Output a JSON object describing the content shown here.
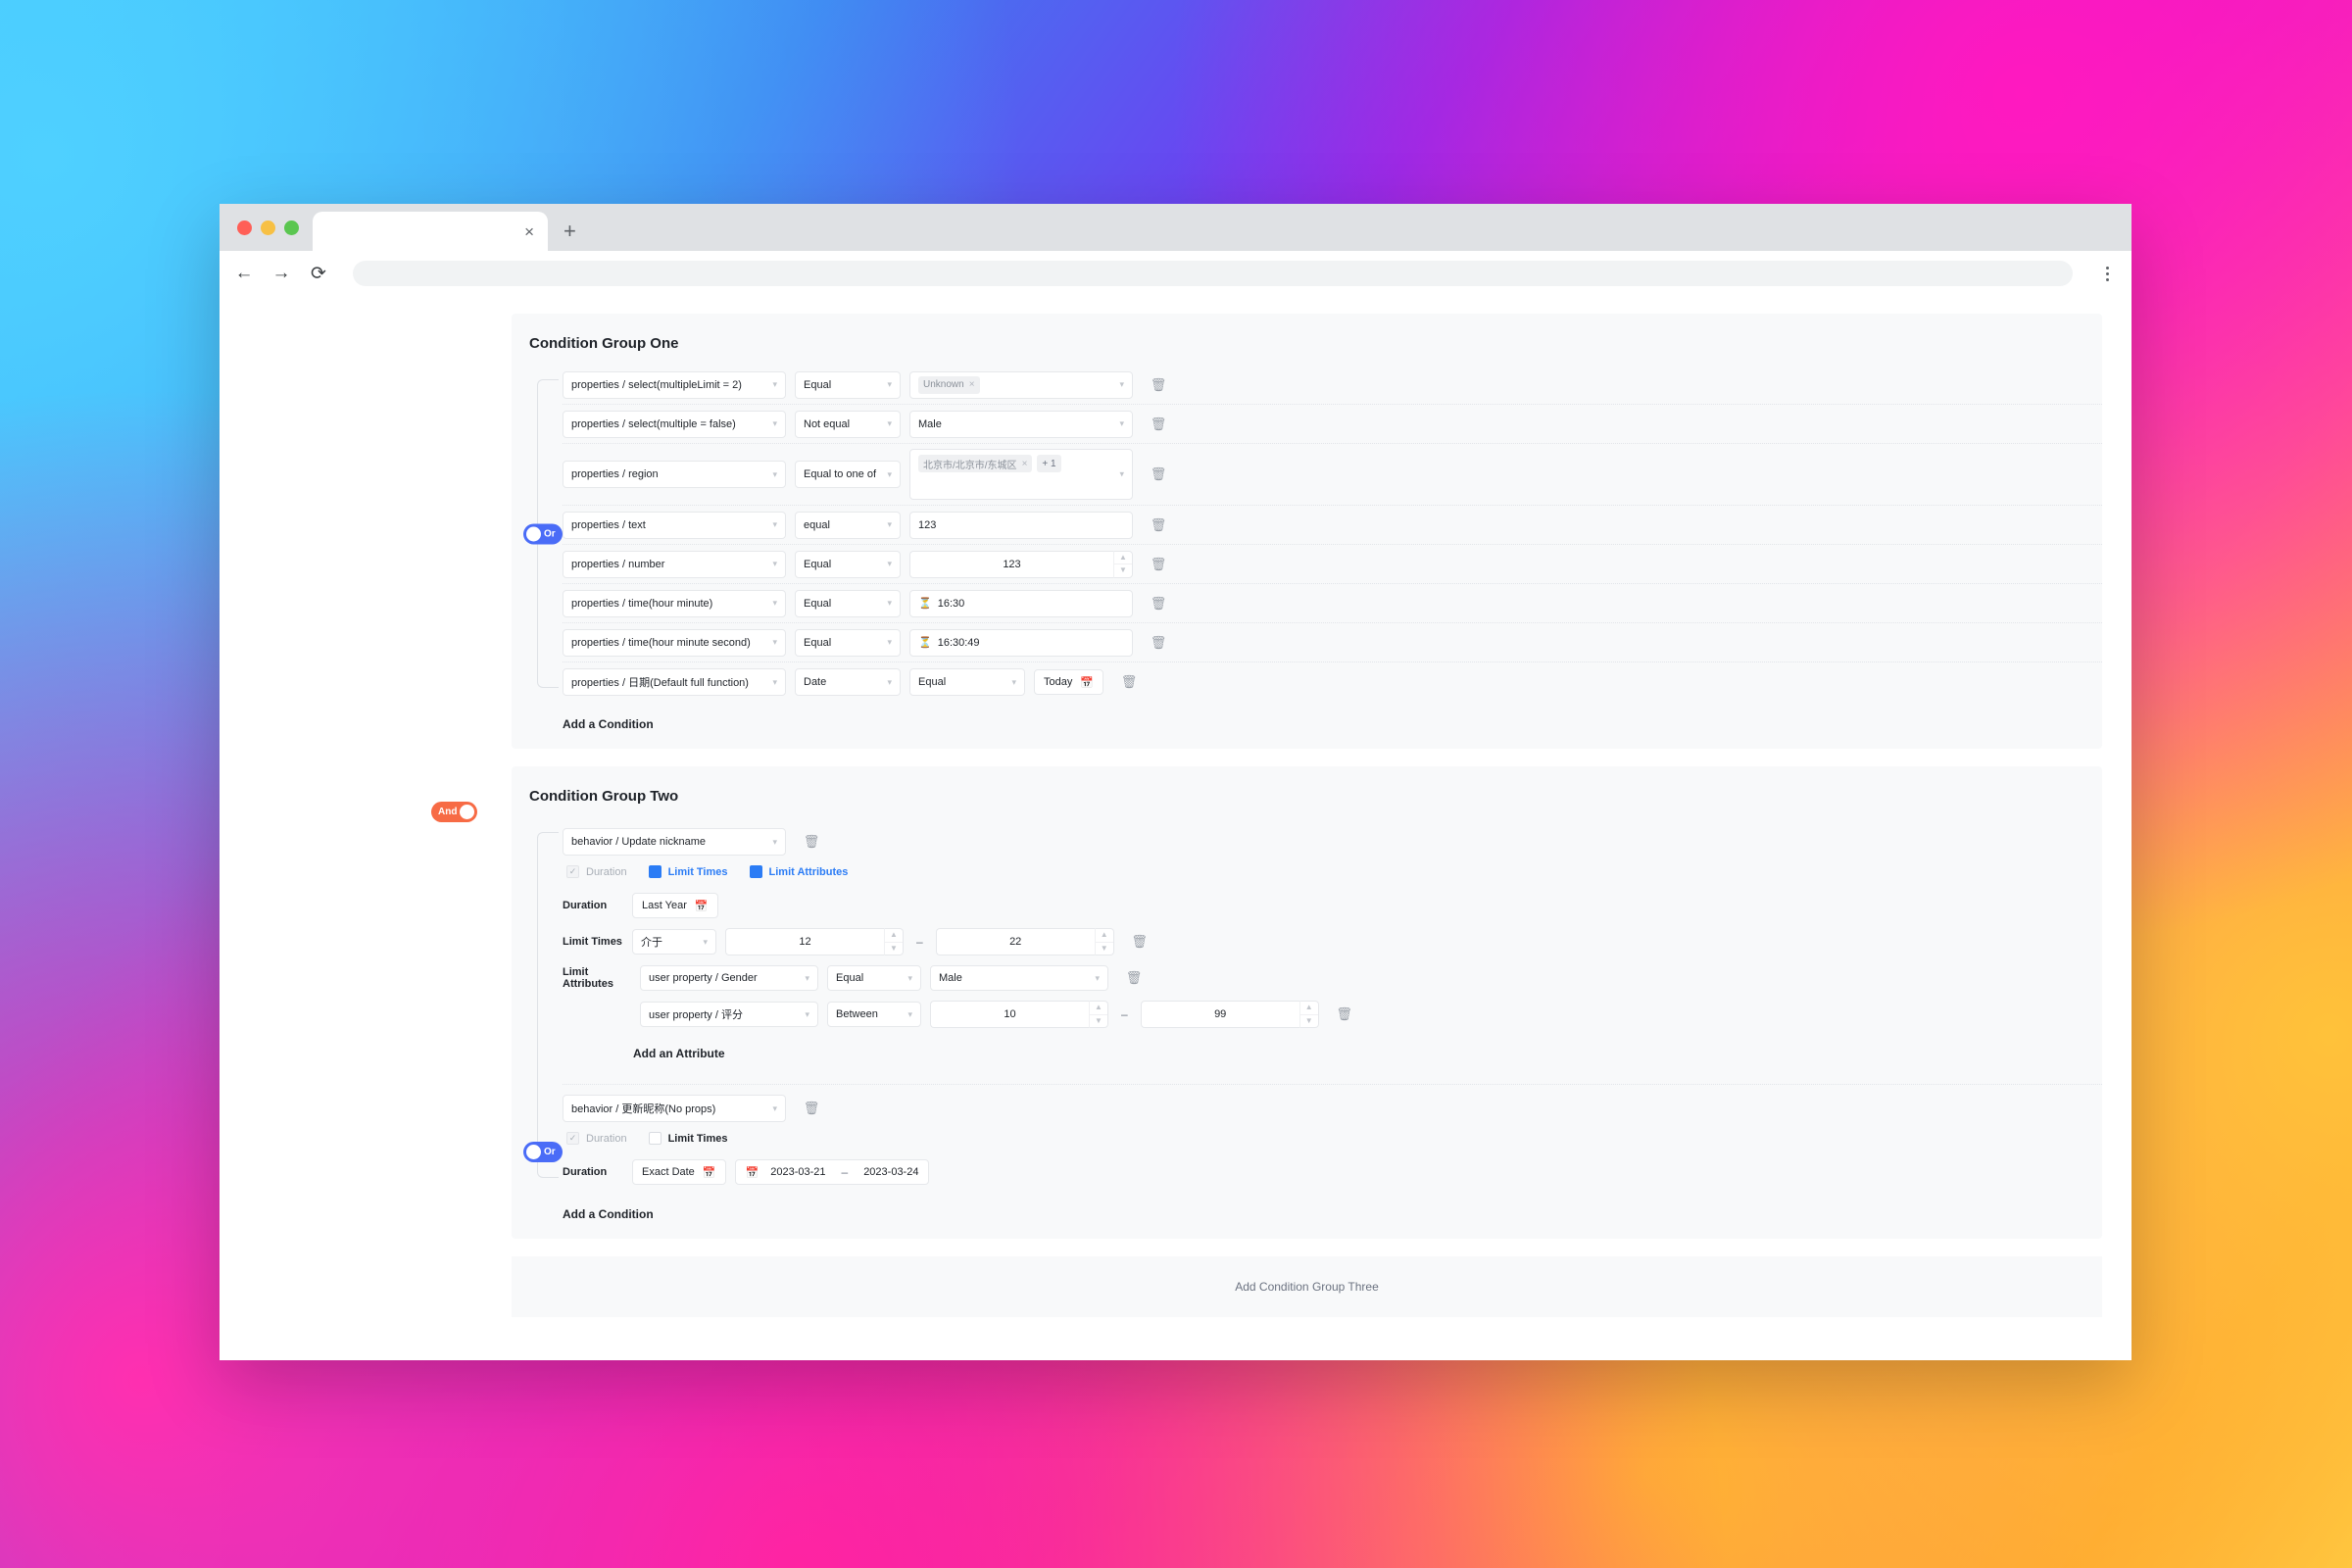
{
  "browser": {
    "tab_title": "",
    "tab_close_label": "×",
    "new_tab_label": "+",
    "back_label": "←",
    "forward_label": "→",
    "reload_label": "⟳",
    "url_value": "",
    "url_placeholder": ""
  },
  "colors": {
    "or_toggle": "#4a6cf7",
    "and_toggle": "#f76b45",
    "checkbox_on": "#2b7cf5",
    "link_text": "#2b7cf5",
    "card_bg": "#f8f9fa"
  },
  "group_one": {
    "title": "Condition Group One",
    "logic_toggle": "Or",
    "add_condition": "Add a Condition",
    "rows": [
      {
        "property": "properties / select(multipleLimit = 2)",
        "operator": "Equal",
        "value_chips": [
          {
            "label": "Unknown",
            "close": "×"
          }
        ],
        "kind": "chips"
      },
      {
        "property": "properties / select(multiple = false)",
        "operator": "Not equal",
        "value": "Male",
        "kind": "select"
      },
      {
        "property": "properties / region",
        "operator": "Equal to one of",
        "value_chips": [
          {
            "label": "北京市/北京市/东城区",
            "close": "×"
          },
          {
            "label": "+ 1",
            "close": ""
          }
        ],
        "kind": "chips-tall"
      },
      {
        "property": "properties / text",
        "operator": "equal",
        "value": "123",
        "kind": "text"
      },
      {
        "property": "properties / number",
        "operator": "Equal",
        "value": "123",
        "kind": "number"
      },
      {
        "property": "properties / time(hour minute)",
        "operator": "Equal",
        "value": "16:30",
        "icon": "clock-icon",
        "kind": "time"
      },
      {
        "property": "properties / time(hour minute second)",
        "operator": "Equal",
        "value": "16:30:49",
        "icon": "clock-icon",
        "kind": "time"
      },
      {
        "property": "properties / 日期(Default full function)",
        "operator": "Date",
        "operator2": "Equal",
        "value": "Today",
        "kind": "date"
      }
    ]
  },
  "group_two": {
    "title": "Condition Group Two",
    "group_logic_toggle": "And",
    "inner_logic_toggle": "Or",
    "add_condition": "Add a Condition",
    "behavior_one": {
      "name": "behavior / Update nickname",
      "checkboxes": [
        {
          "label": "Duration",
          "state": "disabled-checked"
        },
        {
          "label": "Limit Times",
          "state": "checked"
        },
        {
          "label": "Limit Attributes",
          "state": "checked"
        }
      ],
      "duration_label": "Duration",
      "duration_value": "Last Year",
      "limit_times_label": "Limit Times",
      "limit_times_operator": "介于",
      "limit_times_from": "12",
      "limit_times_to": "22",
      "range_dash": "–",
      "limit_attributes_label": "Limit Attributes",
      "attributes": [
        {
          "property": "user property / Gender",
          "operator": "Equal",
          "value": "Male",
          "kind": "select"
        },
        {
          "property": "user property / 评分",
          "operator": "Between",
          "from": "10",
          "to": "99",
          "kind": "range"
        }
      ],
      "add_attribute": "Add an Attribute"
    },
    "behavior_two": {
      "name": "behavior / 更新昵称(No props)",
      "checkboxes": [
        {
          "label": "Duration",
          "state": "disabled-checked"
        },
        {
          "label": "Limit Times",
          "state": "unchecked"
        }
      ],
      "duration_label": "Duration",
      "duration_mode": "Exact Date",
      "date_start": "2023-03-21",
      "date_end": "2023-03-24",
      "date_dash": "–"
    }
  },
  "footer": {
    "add_group": "Add Condition Group Three"
  },
  "icons": {
    "trash": "Ὕ1",
    "caret": "∨",
    "calendar": "Ὄ5",
    "clock": "ὕ4",
    "check": "✓",
    "up": "∧",
    "down": "∨"
  }
}
